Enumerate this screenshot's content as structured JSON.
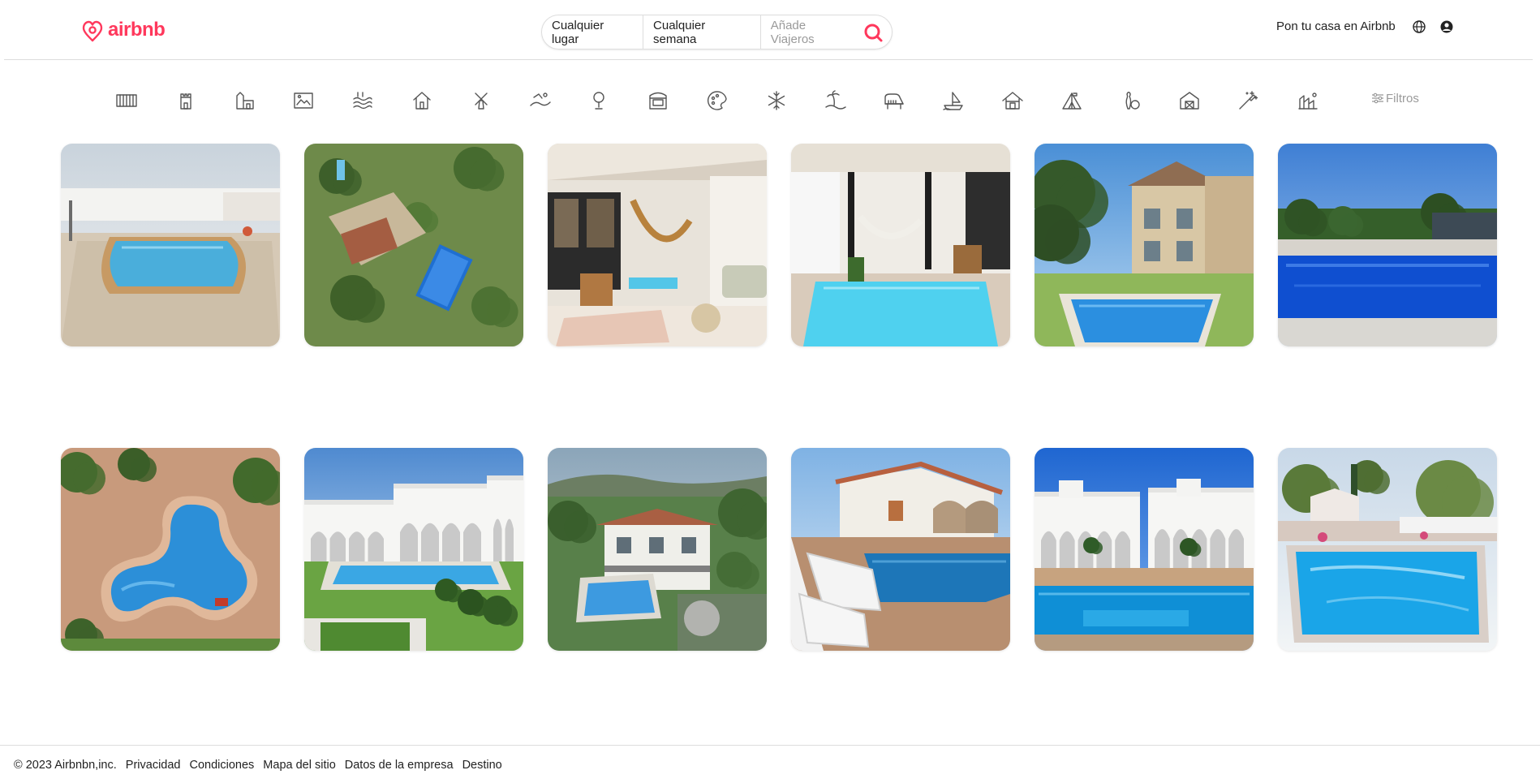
{
  "header": {
    "brand": "airbnb",
    "brand_color": "#FF385C",
    "search": {
      "where": "Cualquier lugar",
      "when": "Cualquier semana",
      "who_placeholder": "Añade Viajeros",
      "search_icon": "search-icon"
    },
    "host_link": "Pon tu casa en Airbnb",
    "globe_icon": "globe-icon",
    "user_icon": "user-icon"
  },
  "categories": {
    "icons": [
      "beachfront-icon",
      "castle-icon",
      "castles-icon",
      "photo-icon",
      "lakefront-icon",
      "tiny-home-icon",
      "windmill-icon",
      "surfing-icon",
      "golf-icon",
      "design-icon",
      "creative-icon",
      "arctic-icon",
      "island-icon",
      "grand-piano-icon",
      "boat-icon",
      "cabin-icon",
      "camping-icon",
      "bowling-icon",
      "barn-icon",
      "magic-icon",
      "vineyard-icon"
    ],
    "filters_label": "Filtros",
    "filters_icon": "sliders-icon"
  },
  "listings": [
    {
      "name": "listing-1",
      "scene": "pool-courtyard"
    },
    {
      "name": "listing-2",
      "scene": "aerial-villa"
    },
    {
      "name": "listing-3",
      "scene": "patio-hammock"
    },
    {
      "name": "listing-4",
      "scene": "indoor-pool-hammock"
    },
    {
      "name": "listing-5",
      "scene": "townhouse-pool"
    },
    {
      "name": "listing-6",
      "scene": "blue-pool-garden"
    },
    {
      "name": "listing-7",
      "scene": "aerial-kidney-pool"
    },
    {
      "name": "listing-8",
      "scene": "apartment-complex-pool"
    },
    {
      "name": "listing-9",
      "scene": "mountain-house-pool"
    },
    {
      "name": "listing-10",
      "scene": "white-house-terrace"
    },
    {
      "name": "listing-11",
      "scene": "white-villas-pool"
    },
    {
      "name": "listing-12",
      "scene": "garden-pool"
    }
  ],
  "footer": {
    "copyright": "© 2023 Airbnbn,inc.",
    "links": [
      "Privacidad",
      "Condiciones",
      "Mapa del sitio",
      "Datos de la empresa",
      "Destino"
    ]
  }
}
